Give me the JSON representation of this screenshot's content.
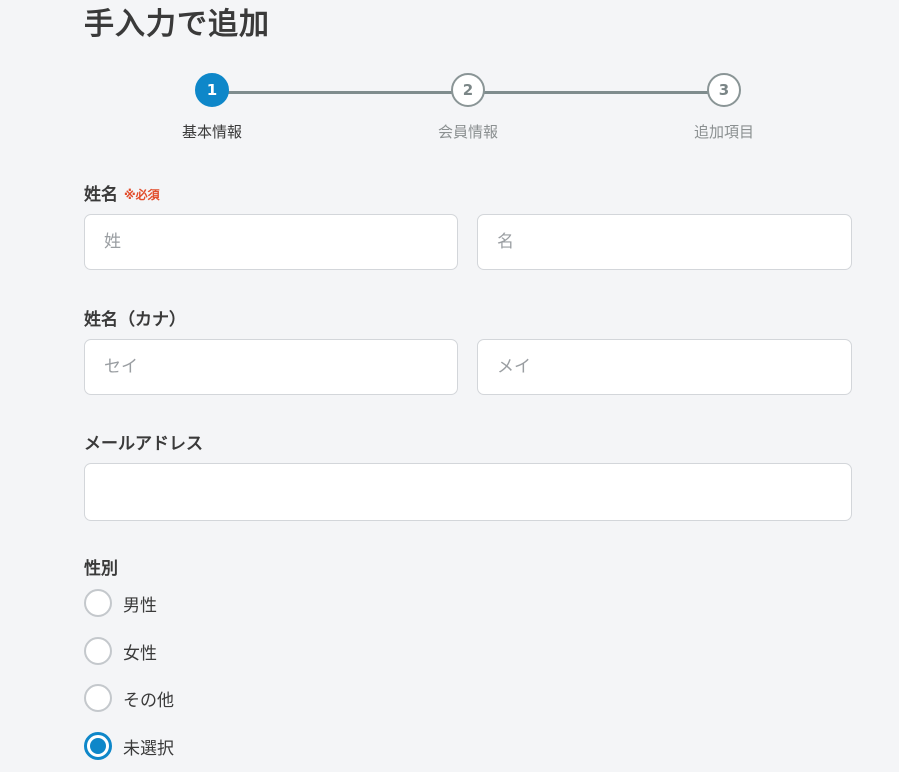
{
  "page": {
    "title": "手入力で追加"
  },
  "stepper": {
    "steps": [
      {
        "number": "1",
        "label": "基本情報",
        "active": true
      },
      {
        "number": "2",
        "label": "会員情報",
        "active": false
      },
      {
        "number": "3",
        "label": "追加項目",
        "active": false
      }
    ]
  },
  "form": {
    "name": {
      "label": "姓名",
      "required": "※必須",
      "last_placeholder": "姓",
      "first_placeholder": "名"
    },
    "kana": {
      "label": "姓名（カナ）",
      "last_placeholder": "セイ",
      "first_placeholder": "メイ"
    },
    "email": {
      "label": "メールアドレス",
      "value": ""
    },
    "gender": {
      "label": "性別",
      "options": [
        {
          "label": "男性",
          "checked": false
        },
        {
          "label": "女性",
          "checked": false
        },
        {
          "label": "その他",
          "checked": false
        },
        {
          "label": "未選択",
          "checked": true
        }
      ]
    }
  },
  "colors": {
    "accent": "#0e87c9",
    "required": "#e24d2c",
    "background": "#f4f5f7"
  }
}
